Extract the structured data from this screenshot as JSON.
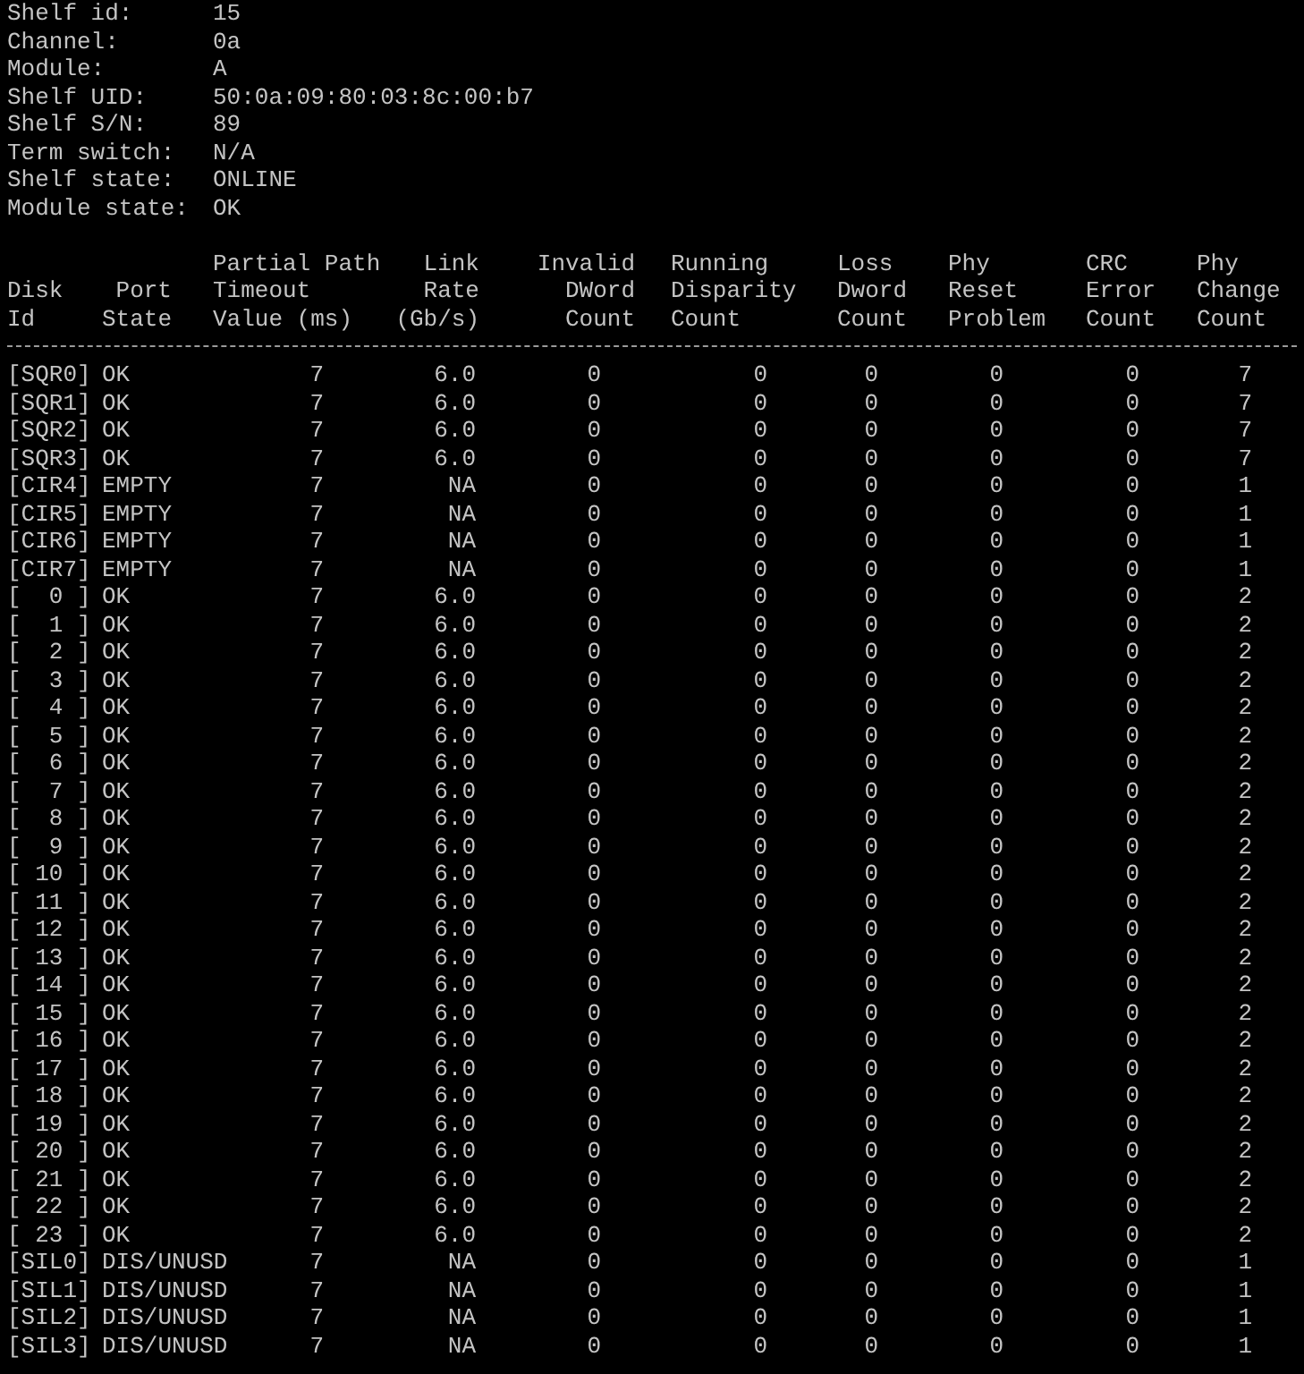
{
  "shelf_info": [
    {
      "label": "Shelf id:",
      "value": "15"
    },
    {
      "label": "Channel:",
      "value": "0a"
    },
    {
      "label": "Module:",
      "value": "A"
    },
    {
      "label": "Shelf UID:",
      "value": "50:0a:09:80:03:8c:00:b7"
    },
    {
      "label": "Shelf S/N:",
      "value": "89"
    },
    {
      "label": "Term switch:",
      "value": "N/A"
    },
    {
      "label": "Shelf state:",
      "value": "ONLINE"
    },
    {
      "label": "Module state:",
      "value": "OK"
    }
  ],
  "table": {
    "columns": [
      "Disk\nId",
      "Port\nState",
      "Partial Path\nTimeout\nValue (ms)",
      "Link\nRate\n(Gb/s)",
      "Invalid\nDWord\nCount",
      "Running\nDisparity\nCount",
      "Loss\nDword\nCount",
      "Phy\nReset\nProblem",
      "CRC\nError\nCount",
      "Phy\nChange\nCount"
    ],
    "rows": [
      [
        "[SQR0]",
        "OK",
        "7",
        "6.0",
        "0",
        "0",
        "0",
        "0",
        "0",
        "7"
      ],
      [
        "[SQR1]",
        "OK",
        "7",
        "6.0",
        "0",
        "0",
        "0",
        "0",
        "0",
        "7"
      ],
      [
        "[SQR2]",
        "OK",
        "7",
        "6.0",
        "0",
        "0",
        "0",
        "0",
        "0",
        "7"
      ],
      [
        "[SQR3]",
        "OK",
        "7",
        "6.0",
        "0",
        "0",
        "0",
        "0",
        "0",
        "7"
      ],
      [
        "[CIR4]",
        "EMPTY",
        "7",
        "NA",
        "0",
        "0",
        "0",
        "0",
        "0",
        "1"
      ],
      [
        "[CIR5]",
        "EMPTY",
        "7",
        "NA",
        "0",
        "0",
        "0",
        "0",
        "0",
        "1"
      ],
      [
        "[CIR6]",
        "EMPTY",
        "7",
        "NA",
        "0",
        "0",
        "0",
        "0",
        "0",
        "1"
      ],
      [
        "[CIR7]",
        "EMPTY",
        "7",
        "NA",
        "0",
        "0",
        "0",
        "0",
        "0",
        "1"
      ],
      [
        "[  0 ]",
        "OK",
        "7",
        "6.0",
        "0",
        "0",
        "0",
        "0",
        "0",
        "2"
      ],
      [
        "[  1 ]",
        "OK",
        "7",
        "6.0",
        "0",
        "0",
        "0",
        "0",
        "0",
        "2"
      ],
      [
        "[  2 ]",
        "OK",
        "7",
        "6.0",
        "0",
        "0",
        "0",
        "0",
        "0",
        "2"
      ],
      [
        "[  3 ]",
        "OK",
        "7",
        "6.0",
        "0",
        "0",
        "0",
        "0",
        "0",
        "2"
      ],
      [
        "[  4 ]",
        "OK",
        "7",
        "6.0",
        "0",
        "0",
        "0",
        "0",
        "0",
        "2"
      ],
      [
        "[  5 ]",
        "OK",
        "7",
        "6.0",
        "0",
        "0",
        "0",
        "0",
        "0",
        "2"
      ],
      [
        "[  6 ]",
        "OK",
        "7",
        "6.0",
        "0",
        "0",
        "0",
        "0",
        "0",
        "2"
      ],
      [
        "[  7 ]",
        "OK",
        "7",
        "6.0",
        "0",
        "0",
        "0",
        "0",
        "0",
        "2"
      ],
      [
        "[  8 ]",
        "OK",
        "7",
        "6.0",
        "0",
        "0",
        "0",
        "0",
        "0",
        "2"
      ],
      [
        "[  9 ]",
        "OK",
        "7",
        "6.0",
        "0",
        "0",
        "0",
        "0",
        "0",
        "2"
      ],
      [
        "[ 10 ]",
        "OK",
        "7",
        "6.0",
        "0",
        "0",
        "0",
        "0",
        "0",
        "2"
      ],
      [
        "[ 11 ]",
        "OK",
        "7",
        "6.0",
        "0",
        "0",
        "0",
        "0",
        "0",
        "2"
      ],
      [
        "[ 12 ]",
        "OK",
        "7",
        "6.0",
        "0",
        "0",
        "0",
        "0",
        "0",
        "2"
      ],
      [
        "[ 13 ]",
        "OK",
        "7",
        "6.0",
        "0",
        "0",
        "0",
        "0",
        "0",
        "2"
      ],
      [
        "[ 14 ]",
        "OK",
        "7",
        "6.0",
        "0",
        "0",
        "0",
        "0",
        "0",
        "2"
      ],
      [
        "[ 15 ]",
        "OK",
        "7",
        "6.0",
        "0",
        "0",
        "0",
        "0",
        "0",
        "2"
      ],
      [
        "[ 16 ]",
        "OK",
        "7",
        "6.0",
        "0",
        "0",
        "0",
        "0",
        "0",
        "2"
      ],
      [
        "[ 17 ]",
        "OK",
        "7",
        "6.0",
        "0",
        "0",
        "0",
        "0",
        "0",
        "2"
      ],
      [
        "[ 18 ]",
        "OK",
        "7",
        "6.0",
        "0",
        "0",
        "0",
        "0",
        "0",
        "2"
      ],
      [
        "[ 19 ]",
        "OK",
        "7",
        "6.0",
        "0",
        "0",
        "0",
        "0",
        "0",
        "2"
      ],
      [
        "[ 20 ]",
        "OK",
        "7",
        "6.0",
        "0",
        "0",
        "0",
        "0",
        "0",
        "2"
      ],
      [
        "[ 21 ]",
        "OK",
        "7",
        "6.0",
        "0",
        "0",
        "0",
        "0",
        "0",
        "2"
      ],
      [
        "[ 22 ]",
        "OK",
        "7",
        "6.0",
        "0",
        "0",
        "0",
        "0",
        "0",
        "2"
      ],
      [
        "[ 23 ]",
        "OK",
        "7",
        "6.0",
        "0",
        "0",
        "0",
        "0",
        "0",
        "2"
      ],
      [
        "[SIL0]",
        "DIS/UNUSD",
        "7",
        "NA",
        "0",
        "0",
        "0",
        "0",
        "0",
        "1"
      ],
      [
        "[SIL1]",
        "DIS/UNUSD",
        "7",
        "NA",
        "0",
        "0",
        "0",
        "0",
        "0",
        "1"
      ],
      [
        "[SIL2]",
        "DIS/UNUSD",
        "7",
        "NA",
        "0",
        "0",
        "0",
        "0",
        "0",
        "1"
      ],
      [
        "[SIL3]",
        "DIS/UNUSD",
        "7",
        "NA",
        "0",
        "0",
        "0",
        "0",
        "0",
        "1"
      ]
    ]
  }
}
